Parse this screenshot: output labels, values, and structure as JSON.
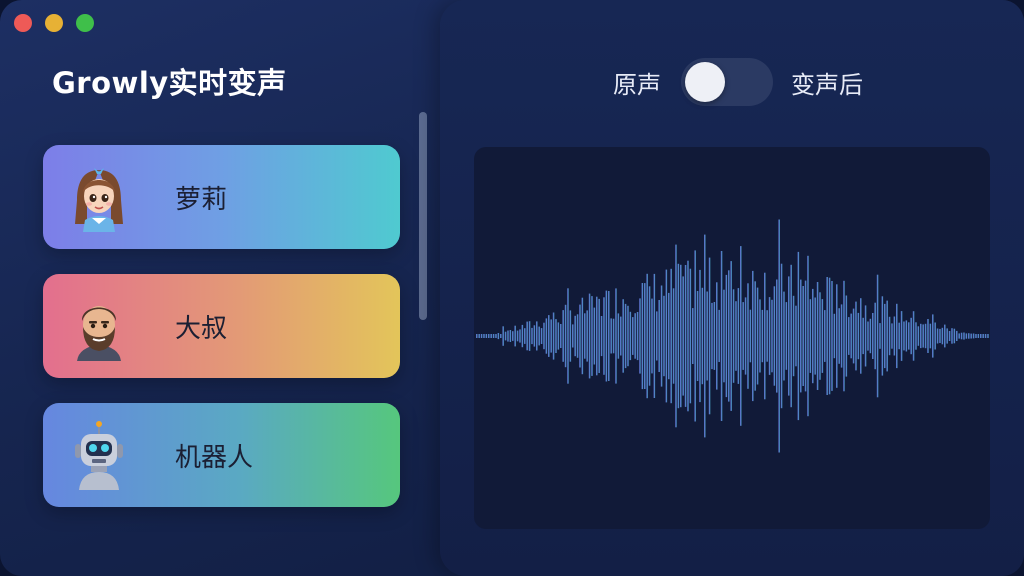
{
  "window": {
    "title": "Growly实时变声",
    "controls": [
      "close",
      "minimize",
      "maximize"
    ]
  },
  "voices": [
    {
      "label": "萝莉",
      "icon": "girl-avatar-icon",
      "gradient": [
        "#7d7ee8",
        "#4fcad0"
      ]
    },
    {
      "label": "大叔",
      "icon": "bearded-man-avatar-icon",
      "gradient": [
        "#e36f8e",
        "#e3c55a"
      ]
    },
    {
      "label": "机器人",
      "icon": "robot-avatar-icon",
      "gradient": [
        "#6687e0",
        "#56c77d"
      ]
    }
  ],
  "monitor": {
    "left_label": "原声",
    "right_label": "变声后",
    "toggle_state": "off"
  },
  "waveform": {
    "colors": [
      "#6f6ee6",
      "#4fb6d8"
    ]
  },
  "colors": {
    "background": "#16254f",
    "close": "#ee5a57",
    "minimize": "#e7b135",
    "maximize": "#3fbf4a"
  }
}
